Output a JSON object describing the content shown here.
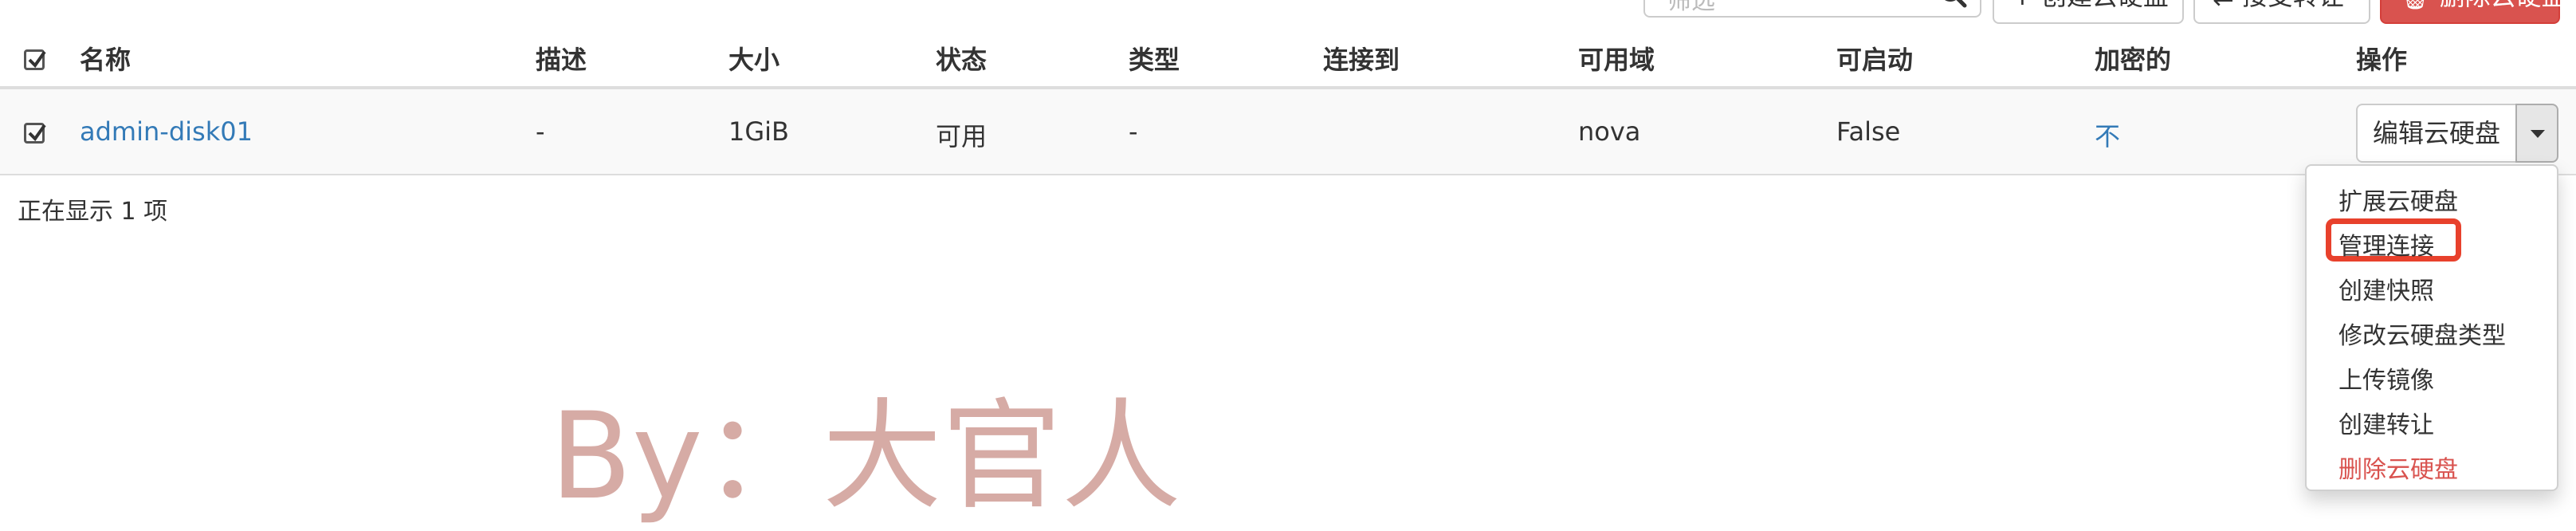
{
  "toolbar": {
    "search_placeholder": "筛选",
    "create_label": "创建云硬盘",
    "transfer_label": "接受转让",
    "delete_label": "删除云硬盘",
    "delete_color": "#d9534f"
  },
  "table": {
    "columns": [
      "名称",
      "描述",
      "大小",
      "状态",
      "类型",
      "连接到",
      "可用域",
      "可启动",
      "加密的",
      "操作"
    ],
    "rows": [
      {
        "name": "admin-disk01",
        "description": "-",
        "size": "1GiB",
        "status": "可用",
        "type": "-",
        "attached_to": "",
        "availability_zone": "nova",
        "bootable": "False",
        "encrypted": "不",
        "action_label": "编辑云硬盘"
      }
    ]
  },
  "footer": {
    "count_text": "正在显示 1 项"
  },
  "dropdown": {
    "items": [
      "扩展云硬盘",
      "管理连接",
      "创建快照",
      "修改云硬盘类型",
      "上传镜像",
      "创建转让",
      "删除云硬盘"
    ],
    "highlighted_item": "管理连接",
    "highlight_color": "#e8412c"
  },
  "watermark": {
    "text": "By：大官人"
  },
  "colors": {
    "link": "#337ab7",
    "danger": "#d9534f"
  },
  "icons": [
    "search-icon",
    "plus-icon",
    "transfer-icon",
    "trash-icon",
    "checkbox-icon",
    "chevron-down-icon"
  ]
}
